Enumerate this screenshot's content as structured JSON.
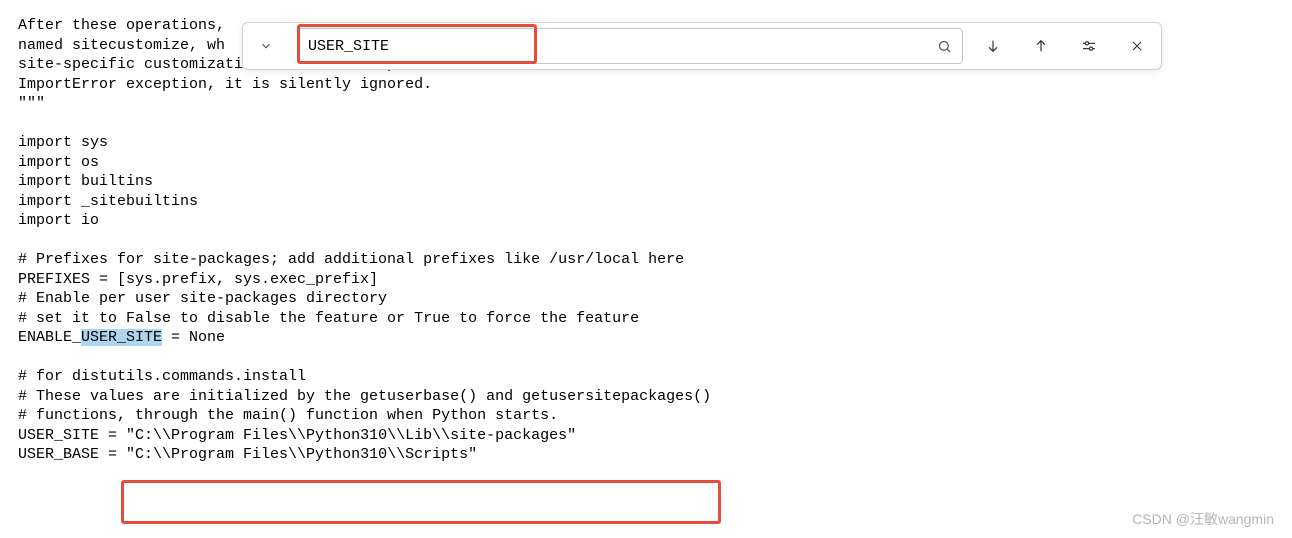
{
  "code": {
    "l1": "After these operations,",
    "l2": "named sitecustomize, wh",
    "l3": "site-specific customizations.  If this import fails with an",
    "l4": "ImportError exception, it is silently ignored.",
    "l5": "\"\"\"",
    "l6": "",
    "l7": "import sys",
    "l8": "import os",
    "l9": "import builtins",
    "l10": "import _sitebuiltins",
    "l11": "import io",
    "l12": "",
    "l13": "# Prefixes for site-packages; add additional prefixes like /usr/local here",
    "l14": "PREFIXES = [sys.prefix, sys.exec_prefix]",
    "l15": "# Enable per user site-packages directory",
    "l16": "# set it to False to disable the feature or True to force the feature",
    "l17a": "ENABLE_",
    "l17b": "USER_SITE",
    "l17c": " = None",
    "l18": "",
    "l19": "# for distutils.commands.install",
    "l20": "# These values are initialized by the getuserbase() and getusersitepackages()",
    "l21": "# functions, through the main() function when Python starts.",
    "l22a": "USER_SITE = ",
    "l22b": "\"C:\\\\Program Files\\\\Python310\\\\Lib\\\\site-packages\"",
    "l23a": "USER_BASE = ",
    "l23b": "\"C:\\\\Program Files\\\\Python310\\\\Scripts\""
  },
  "find": {
    "value": "USER_SITE"
  },
  "watermark": "CSDN @汪敏wangmin"
}
